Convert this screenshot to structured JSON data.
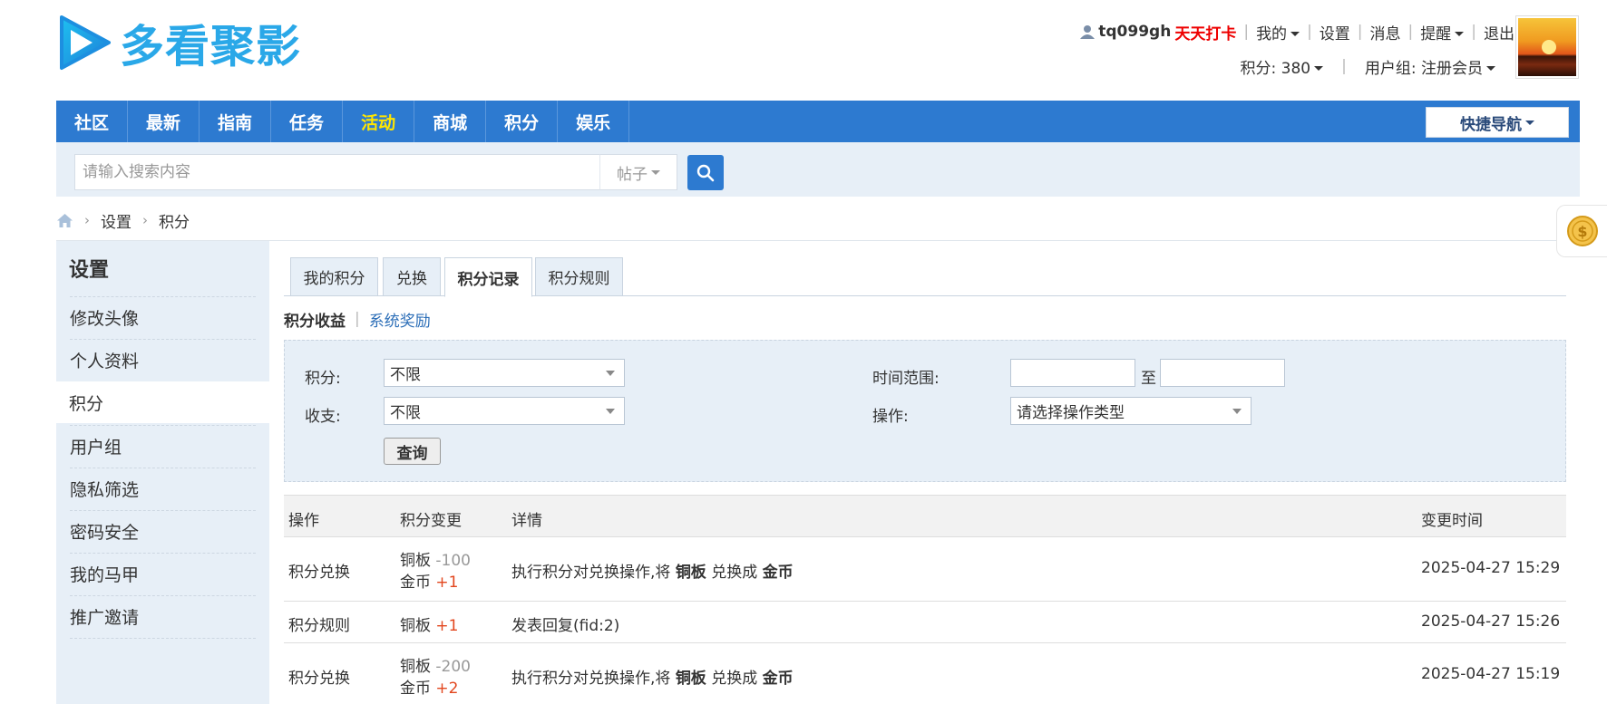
{
  "brand": {
    "name": "多看聚影"
  },
  "user": {
    "username": "tq099gh",
    "checkin": "天天打卡",
    "links": [
      "我的",
      "设置",
      "消息",
      "提醒",
      "退出"
    ],
    "points_label": "积分: 380",
    "group_label": "用户组: 注册会员"
  },
  "nav": {
    "items": [
      "社区",
      "最新",
      "指南",
      "任务",
      "活动",
      "商城",
      "积分",
      "娱乐"
    ],
    "active": "活动",
    "quick_nav": "快捷导航"
  },
  "search": {
    "placeholder": "请输入搜索内容",
    "type": "帖子"
  },
  "breadcrumb": [
    "设置",
    "积分"
  ],
  "sidebar": {
    "title": "设置",
    "items": [
      "修改头像",
      "个人资料",
      "积分",
      "用户组",
      "隐私筛选",
      "密码安全",
      "我的马甲",
      "推广邀请"
    ],
    "active": "积分"
  },
  "tabs": [
    "我的积分",
    "兑换",
    "积分记录",
    "积分规则"
  ],
  "active_tab": "积分记录",
  "subtabs": {
    "active": "积分收益",
    "other": "系统奖励"
  },
  "filter": {
    "points_label": "积分:",
    "points_value": "不限",
    "flow_label": "收支:",
    "flow_value": "不限",
    "time_label": "时间范围:",
    "time_to": "至",
    "op_label": "操作:",
    "op_value": "请选择操作类型",
    "query_button": "查询"
  },
  "table": {
    "headers": [
      "操作",
      "积分变更",
      "详情",
      "变更时间"
    ],
    "rows": [
      {
        "op": "积分兑换",
        "changes": [
          {
            "name": "铜板",
            "delta": "-100"
          },
          {
            "name": "金币",
            "delta": "+1"
          }
        ],
        "detail": {
          "prefix": "执行积分对兑换操作,将",
          "from": "铜板",
          "mid": "兑换成",
          "to": "金币"
        },
        "time": "2025-04-27 15:29"
      },
      {
        "op": "积分规则",
        "changes": [
          {
            "name": "铜板",
            "delta": "+1"
          }
        ],
        "detail_text": "发表回复(fid:2)",
        "time": "2025-04-27 15:26"
      },
      {
        "op": "积分兑换",
        "changes": [
          {
            "name": "铜板",
            "delta": "-200"
          },
          {
            "name": "金币",
            "delta": "+2"
          }
        ],
        "detail": {
          "prefix": "执行积分对兑换操作,将",
          "from": "铜板",
          "mid": "兑换成",
          "to": "金币"
        },
        "time": "2025-04-27 15:19"
      }
    ]
  },
  "colors": {
    "nav_bg": "#2d7ad0",
    "nav_active": "#ffe600",
    "brand": "#2aa8e8",
    "checkin": "#ee0000",
    "positive": "#e2461e"
  }
}
